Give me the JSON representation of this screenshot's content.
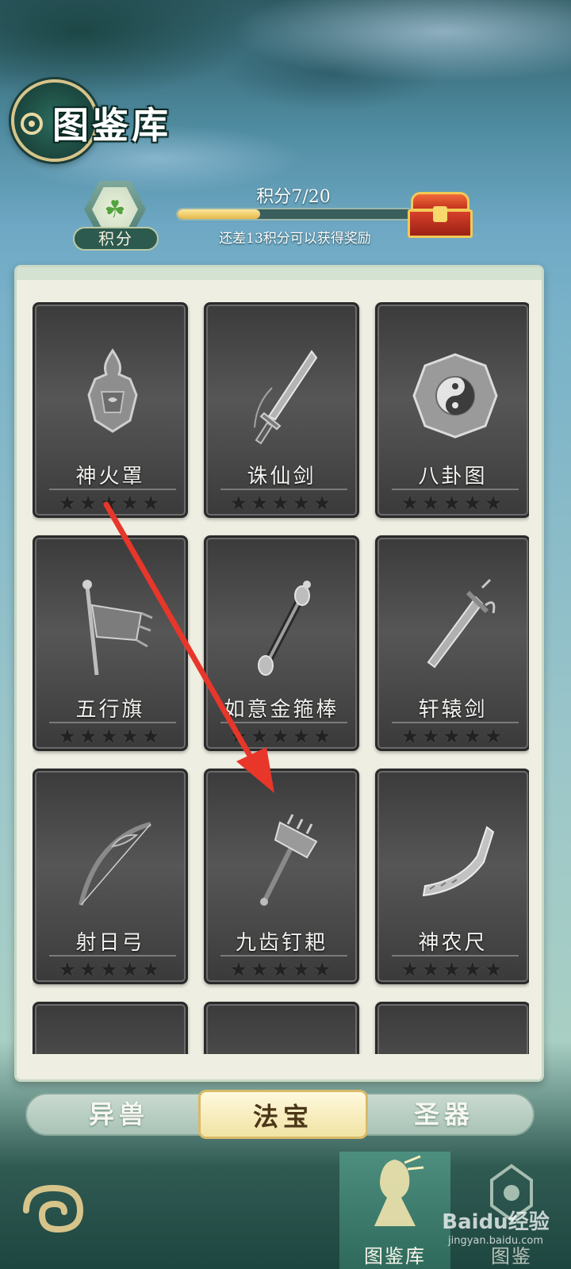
{
  "header": {
    "title": "图鉴库"
  },
  "points": {
    "label": "积分",
    "progress_text": "积分7/20",
    "current": 7,
    "total": 20,
    "progress_fraction": 0.35,
    "hint": "还差13积分可以获得奖励"
  },
  "cards": [
    {
      "name": "神火罩",
      "stars": "★★★★★",
      "icon": "shield-icon"
    },
    {
      "name": "诛仙剑",
      "stars": "★★★★★",
      "icon": "sword-icon"
    },
    {
      "name": "八卦图",
      "stars": "★★★★★",
      "icon": "bagua-icon"
    },
    {
      "name": "五行旗",
      "stars": "★★★★★",
      "icon": "flag-icon"
    },
    {
      "name": "如意金箍棒",
      "stars": "★★★★★",
      "icon": "staff-icon"
    },
    {
      "name": "轩辕剑",
      "stars": "★★★★★",
      "icon": "sword-icon"
    },
    {
      "name": "射日弓",
      "stars": "★★★★★",
      "icon": "bow-icon"
    },
    {
      "name": "九齿钉耙",
      "stars": "★★★★★",
      "icon": "rake-icon"
    },
    {
      "name": "神农尺",
      "stars": "★★★★★",
      "icon": "ruler-icon"
    }
  ],
  "tabs": [
    {
      "label": "异兽",
      "active": false
    },
    {
      "label": "法宝",
      "active": true
    },
    {
      "label": "圣器",
      "active": false
    }
  ],
  "bottom_nav": {
    "active_label": "图鉴库",
    "second_label": "图鉴"
  },
  "watermark": {
    "main": "Baidu经验",
    "sub": "jingyan.baidu.com"
  },
  "colors": {
    "annotation_arrow": "#e8362a",
    "accent_gold": "#d7c48a",
    "progress_fill": "#e6b84a"
  }
}
